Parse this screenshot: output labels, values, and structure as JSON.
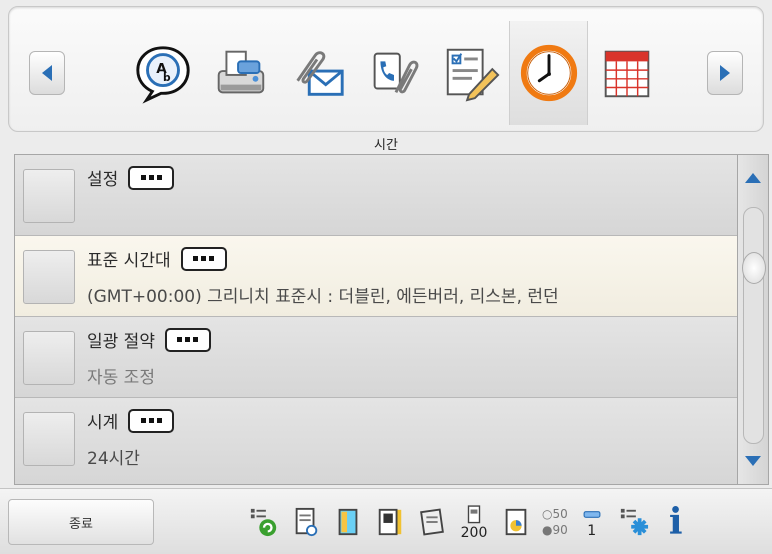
{
  "carousel": {
    "prev_icon": "arrow-left-icon",
    "next_icon": "arrow-right-icon",
    "items": [
      {
        "icon": "language-speech-icon",
        "selected": false
      },
      {
        "icon": "printer-icon",
        "selected": false
      },
      {
        "icon": "attachment-mail-icon",
        "selected": false
      },
      {
        "icon": "phone-attachment-icon",
        "selected": false
      },
      {
        "icon": "form-edit-icon",
        "selected": false
      },
      {
        "icon": "clock-icon",
        "selected": true
      },
      {
        "icon": "calendar-icon",
        "selected": false
      }
    ]
  },
  "section": {
    "title": "시간"
  },
  "list": {
    "items": [
      {
        "title": "설정",
        "value": ""
      },
      {
        "title": "표준 시간대",
        "value": "(GMT+00:00) 그리니치 표준시 : 더블린, 에든버러, 리스본, 런던"
      },
      {
        "title": "일광 절약",
        "value": "자동 조정"
      },
      {
        "title": "시계",
        "value": "24시간"
      }
    ]
  },
  "scrollbar": {
    "position": 0.25
  },
  "footer": {
    "exit_label": "종료",
    "counter_1": "200",
    "pair_top": "50",
    "pair_bottom": "90",
    "counter_2": "1"
  },
  "colors": {
    "accent": "#2a6fb6",
    "clock_orange": "#f07a12"
  }
}
